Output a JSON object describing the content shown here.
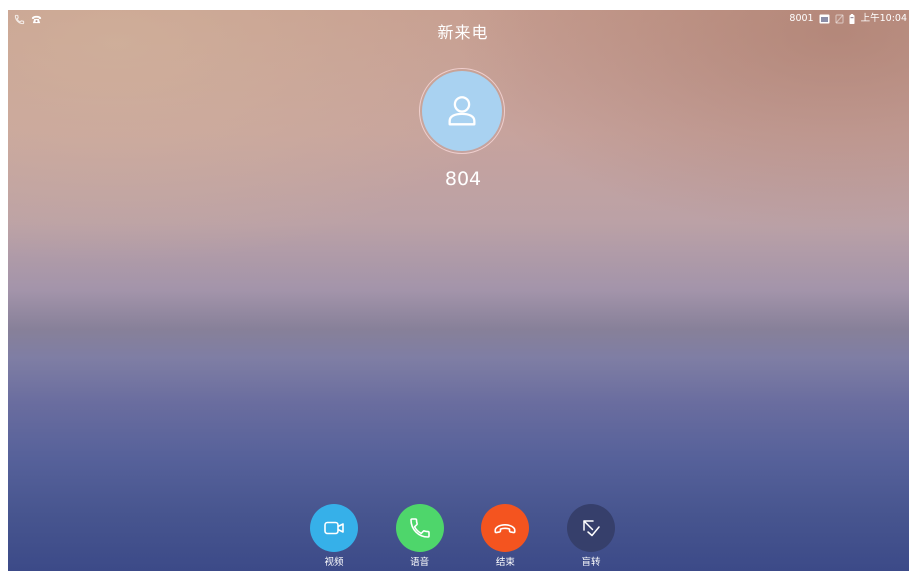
{
  "status_bar": {
    "left_icons": [
      "call-log-icon",
      "telephone-icon"
    ],
    "account": "8001",
    "right_icons": [
      "screen-icon",
      "dnd-icon",
      "battery-icon"
    ],
    "time": "上午10:04"
  },
  "call": {
    "title": "新来电",
    "caller": "804",
    "avatar_icon": "person-icon"
  },
  "colors": {
    "avatar": "#a9d2f1"
  },
  "actions": [
    {
      "label": "视频",
      "icon": "video-icon",
      "color": "#36b0e9"
    },
    {
      "label": "语音",
      "icon": "phone-icon",
      "color": "#4ed66b"
    },
    {
      "label": "结束",
      "icon": "hangup-icon",
      "color": "#f4541f"
    },
    {
      "label": "盲转",
      "icon": "transfer-icon",
      "color": "#363f6b"
    }
  ]
}
